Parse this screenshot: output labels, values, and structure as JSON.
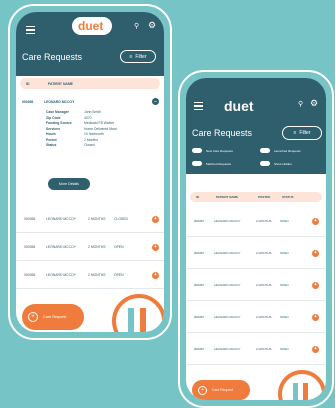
{
  "colors": {
    "background": "#76c4c5",
    "header": "#2f5e6c",
    "accent": "#ef7b3c",
    "table_header": "#fde3d8"
  },
  "left_phone": {
    "logo": "duet",
    "title": "Care Requests",
    "filter_label": "Filter",
    "table_headers": [
      "ID",
      "PATIENT NAME"
    ],
    "expanded_row": {
      "id": "000356",
      "name": "LEONARD MCCOY",
      "details": [
        {
          "label": "Case Manager",
          "value": "John Smith"
        },
        {
          "label": "Zip Code",
          "value": "4070"
        },
        {
          "label": "Funding Source",
          "value": "Medicaid FB Waiver"
        },
        {
          "label": "Services",
          "value": "Home Delivered Meal"
        },
        {
          "label": "Hours",
          "value": "10 hrs/month"
        },
        {
          "label": "Period",
          "value": "2 Months"
        },
        {
          "label": "Status",
          "value": "Closed"
        }
      ],
      "more_details": "More Details"
    },
    "rows": [
      {
        "id": "000356",
        "name": "LEONARD MCCOY",
        "period": "2 MONTHS",
        "status": "CLOSED"
      },
      {
        "id": "000356",
        "name": "LEONARD MCCOY",
        "period": "2 MONTHS",
        "status": "OPEN"
      },
      {
        "id": "000356",
        "name": "LEONARD MCCOY",
        "period": "2 MONTHS",
        "status": "OPEN"
      }
    ],
    "fab_label": "Care Request"
  },
  "right_phone": {
    "logo": "duet",
    "title": "Care Requests",
    "filter_label": "Filter",
    "toggles": [
      "New Care Requests",
      "Launched Requests",
      "Matched Requests",
      "Show Hidden"
    ],
    "table_headers": [
      "ID",
      "PATIENT NAME",
      "POSTED",
      "STATUS"
    ],
    "rows": [
      {
        "id": "000356",
        "name": "LEONARD MCCOY",
        "posted": "2 MONTHS",
        "status": "OPEN"
      },
      {
        "id": "000356",
        "name": "LEONARD MCCOY",
        "posted": "2 MONTHS",
        "status": "OPEN"
      },
      {
        "id": "000356",
        "name": "LEONARD MCCOY",
        "posted": "2 MONTHS",
        "status": "OPEN"
      },
      {
        "id": "000356",
        "name": "LEONARD MCCOY",
        "posted": "2 MONTHS",
        "status": "OPEN"
      },
      {
        "id": "000356",
        "name": "LEONARD MCCOY",
        "posted": "2 MONTHS",
        "status": "OPEN"
      }
    ],
    "fab_label": "Care Request"
  }
}
